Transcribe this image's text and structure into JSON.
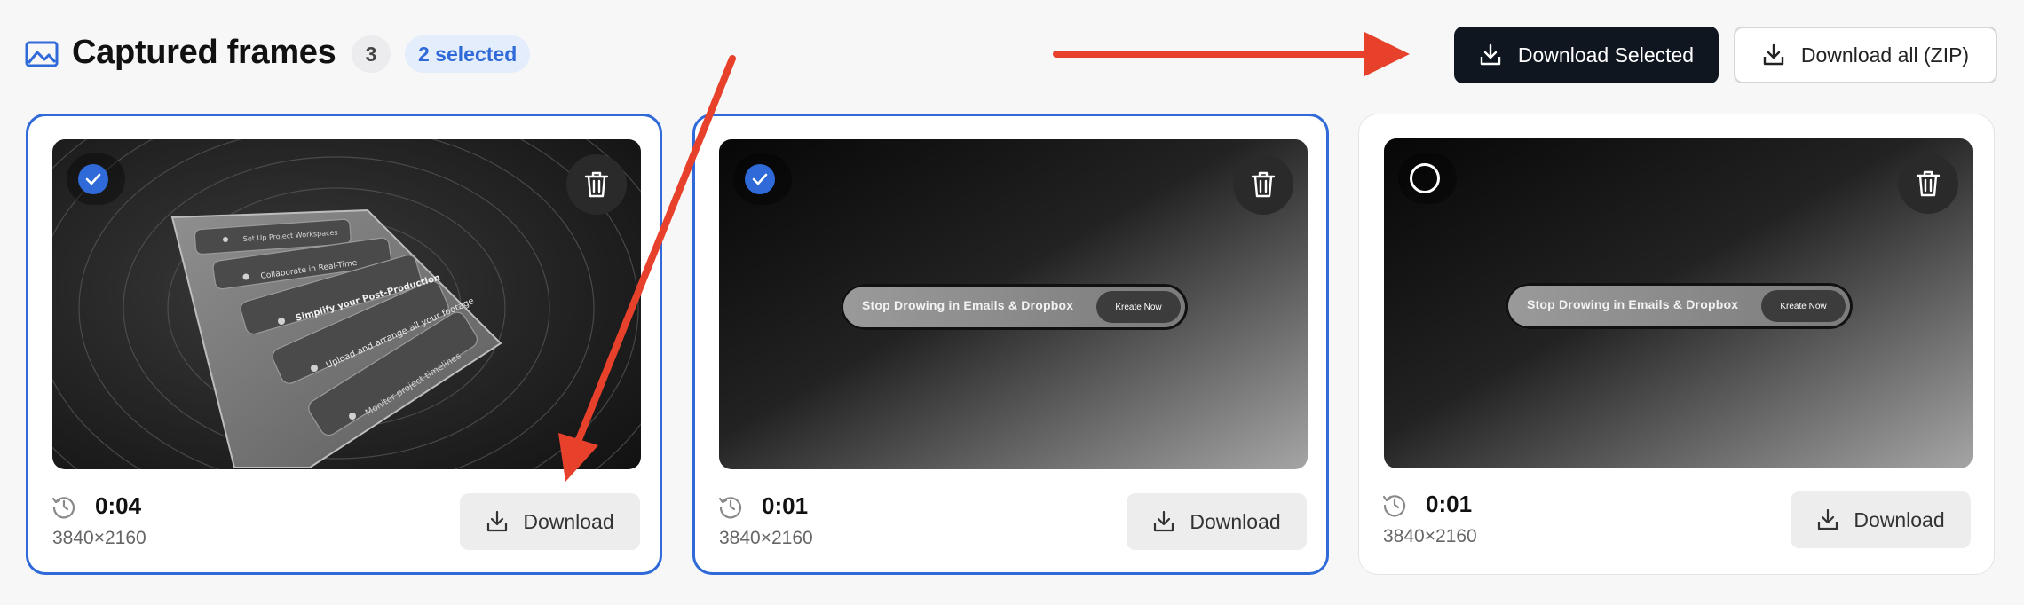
{
  "header": {
    "title": "Captured frames",
    "count": "3",
    "selected_badge": "2 selected",
    "download_selected_label": "Download Selected",
    "download_all_label": "Download all (ZIP)",
    "title_icon": "image-icon"
  },
  "frames": [
    {
      "time": "0:04",
      "resolution": "3840×2160",
      "selected": true,
      "download_label": "Download",
      "thumbnail": {
        "rows": [
          "Set Up Project Workspaces",
          "Collaborate in Real-Time",
          "Simplify your Post-Production",
          "Upload and arrange all your footage",
          "Monitor project timelines"
        ]
      }
    },
    {
      "time": "0:01",
      "resolution": "3840×2160",
      "selected": true,
      "download_label": "Download",
      "thumbnail": {
        "banner_text": "Stop Drowing in Emails & Dropbox",
        "banner_button": "Kreate Now"
      }
    },
    {
      "time": "0:01",
      "resolution": "3840×2160",
      "selected": false,
      "download_label": "Download",
      "thumbnail": {
        "banner_text": "Stop Drowing in Emails & Dropbox",
        "banner_button": "Kreate Now"
      }
    }
  ],
  "colors": {
    "accent": "#2f6ad8",
    "dark_button": "#0f1620",
    "annotation_arrow": "#e8412b"
  },
  "icons": [
    "image-icon",
    "download-icon",
    "trash-icon",
    "check-icon",
    "history-clock-icon"
  ]
}
